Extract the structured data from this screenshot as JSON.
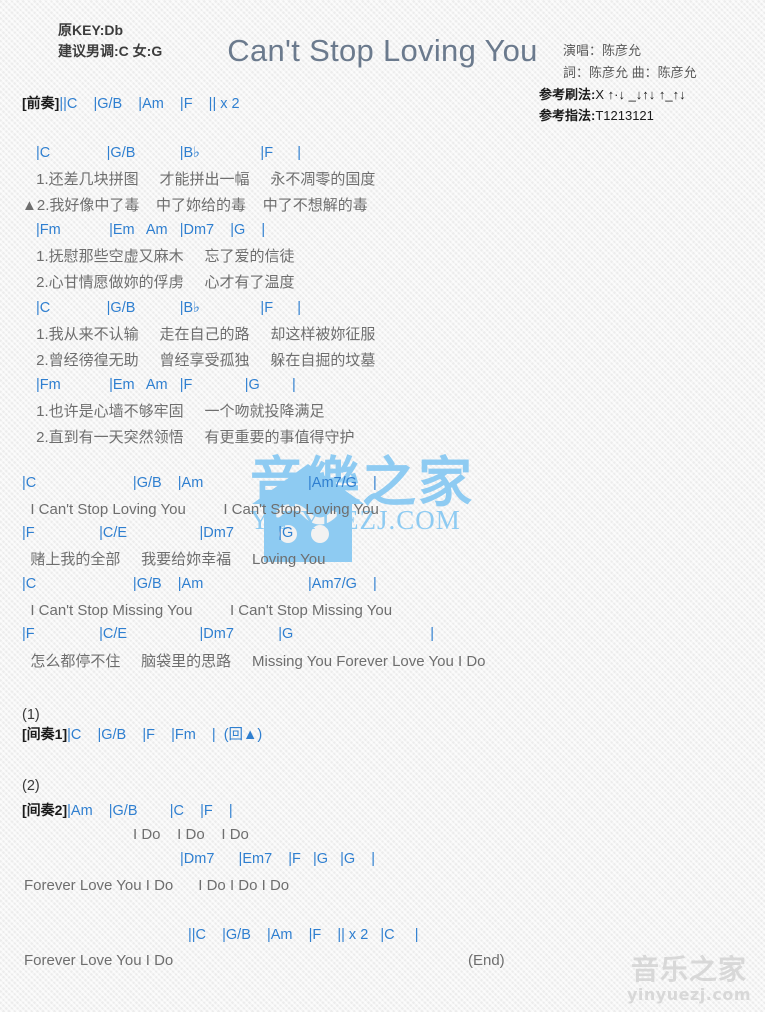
{
  "header": {
    "key_line": "原KEY:Db",
    "suggest_line": "建议男调:C 女:G",
    "title": "Can't Stop Loving You",
    "singer": "演唱：陈彦允",
    "credits": "詞：陈彦允   曲：陈彦允",
    "strum_label": "参考刷法:",
    "strum_pattern": "X ↑·↓ _↓↑↓ ↑_↑↓",
    "finger_label": "参考指法:",
    "finger_pattern": "T1213121"
  },
  "intro": {
    "label": "[前奏]",
    "chords": "||C    |G/B    |Am    |F    || x 2"
  },
  "verse": {
    "block1": {
      "chords": " |C              |G/B           |B♭               |F      |",
      "lyric1": " 1.还差几块拼图     才能拼出一幅     永不凋零的国度",
      "lyric2": "▲2.我好像中了毒    中了妳给的毒    中了不想解的毒"
    },
    "block2": {
      "chords": " |Fm            |Em   Am   |Dm7    |G    |",
      "lyric1": " 1.抚慰那些空虚又麻木     忘了爱的信徒",
      "lyric2": " 2.心甘情愿做妳的俘虏     心才有了温度"
    },
    "block3": {
      "chords": " |C              |G/B           |B♭               |F      |",
      "lyric1": " 1.我从来不认输     走在自己的路     却这样被妳征服",
      "lyric2": " 2.曾经徬徨无助     曾经享受孤独     躲在自掘的坟墓"
    },
    "block4": {
      "chords": " |Fm            |Em   Am   |F             |G        |",
      "lyric1": " 1.也许是心墙不够牢固     一个吻就投降满足",
      "lyric2": " 2.直到有一天突然领悟     有更重要的事值得守护"
    }
  },
  "chorus": {
    "line1_chords": "|C                        |G/B    |Am                          |Am7/G    |",
    "line1_lyric": "  I Can't Stop Loving You         I Can't Stop Loving You",
    "line2_chords": "|F                |C/E                  |Dm7           |G",
    "line2_lyric": "  赌上我的全部     我要给妳幸福     Loving You",
    "line3_chords": "|C                        |G/B    |Am                          |Am7/G    |",
    "line3_lyric": "  I Can't Stop Missing You         I Can't Stop Missing You",
    "line4_chords": "|F                |C/E                  |Dm7           |G                                  |",
    "line4_lyric": "  怎么都停不住     脑袋里的思路     Missing You Forever Love You I Do"
  },
  "interlude1": {
    "number": "(1)",
    "label": "[间奏1]",
    "chords": "|C    |G/B    |F    |Fm    |  (回▲)"
  },
  "interlude2": {
    "number": "(2)",
    "label": "[间奏2]",
    "chords": "|Am    |G/B        |C    |F    |",
    "lyric": "I Do    I Do    I Do",
    "tail_chords": "|Dm7      |Em7    |F   |G   |G    |",
    "tail_lyric": "Forever Love You I Do      I Do I Do I Do"
  },
  "ending": {
    "chords": "||C    |G/B    |Am    |F    || x 2   |C     |",
    "lyric": "Forever Love You I Do",
    "end_mark": "(End)"
  },
  "watermarks": {
    "center_cn": "音樂之家",
    "center_en": "YINYUEZJ.COM",
    "bottom_cn": "音乐之家",
    "bottom_en": "yinyuezj.com",
    "center_color": "#8ecbf2",
    "bottom_color": "#d8d8d8"
  }
}
